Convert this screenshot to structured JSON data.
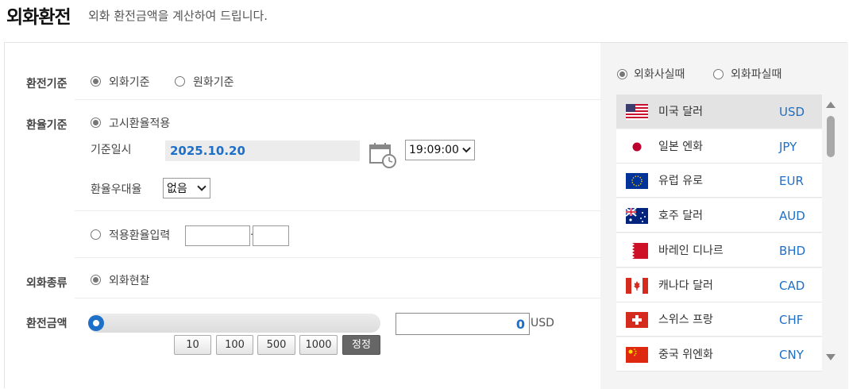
{
  "header": {
    "title": "외화환전",
    "subtitle": "외화 환전금액을 계산하여 드립니다."
  },
  "form": {
    "exchange_basis": {
      "label": "환전기준",
      "options": [
        {
          "label": "외화기준",
          "selected": true
        },
        {
          "label": "원화기준",
          "selected": false
        }
      ]
    },
    "rate_basis": {
      "label": "환율기준",
      "option_announced": "고시환율적용",
      "date_label": "기준일시",
      "date_value": "2025.10.20",
      "time_value": "19:09:00",
      "preferential_label": "환율우대율",
      "preferential_value": "없음",
      "option_manual": "적용환율입력"
    },
    "currency_type": {
      "label": "외화종류",
      "option": "외화현찰"
    },
    "amount": {
      "label": "환전금액",
      "value": "0",
      "unit": "USD",
      "slider_level": 0,
      "buttons": [
        "10",
        "100",
        "500",
        "1000"
      ],
      "reset_label": "정정"
    }
  },
  "right_panel": {
    "trade_options": [
      {
        "label": "외화사실때",
        "selected": true
      },
      {
        "label": "외화파실때",
        "selected": false
      }
    ],
    "currencies": [
      {
        "name": "미국 달러",
        "code": "USD",
        "flag": "us-flag-icon",
        "selected": true
      },
      {
        "name": "일본 엔화",
        "code": "JPY",
        "flag": "japan-flag-icon",
        "selected": false
      },
      {
        "name": "유럽 유로",
        "code": "EUR",
        "flag": "eu-flag-icon",
        "selected": false
      },
      {
        "name": "호주 달러",
        "code": "AUD",
        "flag": "australia-flag-icon",
        "selected": false
      },
      {
        "name": "바레인 디나르",
        "code": "BHD",
        "flag": "bahrain-flag-icon",
        "selected": false
      },
      {
        "name": "캐나다 달러",
        "code": "CAD",
        "flag": "canada-flag-icon",
        "selected": false
      },
      {
        "name": "스위스 프랑",
        "code": "CHF",
        "flag": "switzerland-flag-icon",
        "selected": false
      },
      {
        "name": "중국 위엔화",
        "code": "CNY",
        "flag": "china-flag-icon",
        "selected": false
      }
    ]
  },
  "colors": {
    "accent": "#1e6fc8",
    "panel_bg": "#f4f4f4",
    "selected_row": "#e3e3e3"
  }
}
